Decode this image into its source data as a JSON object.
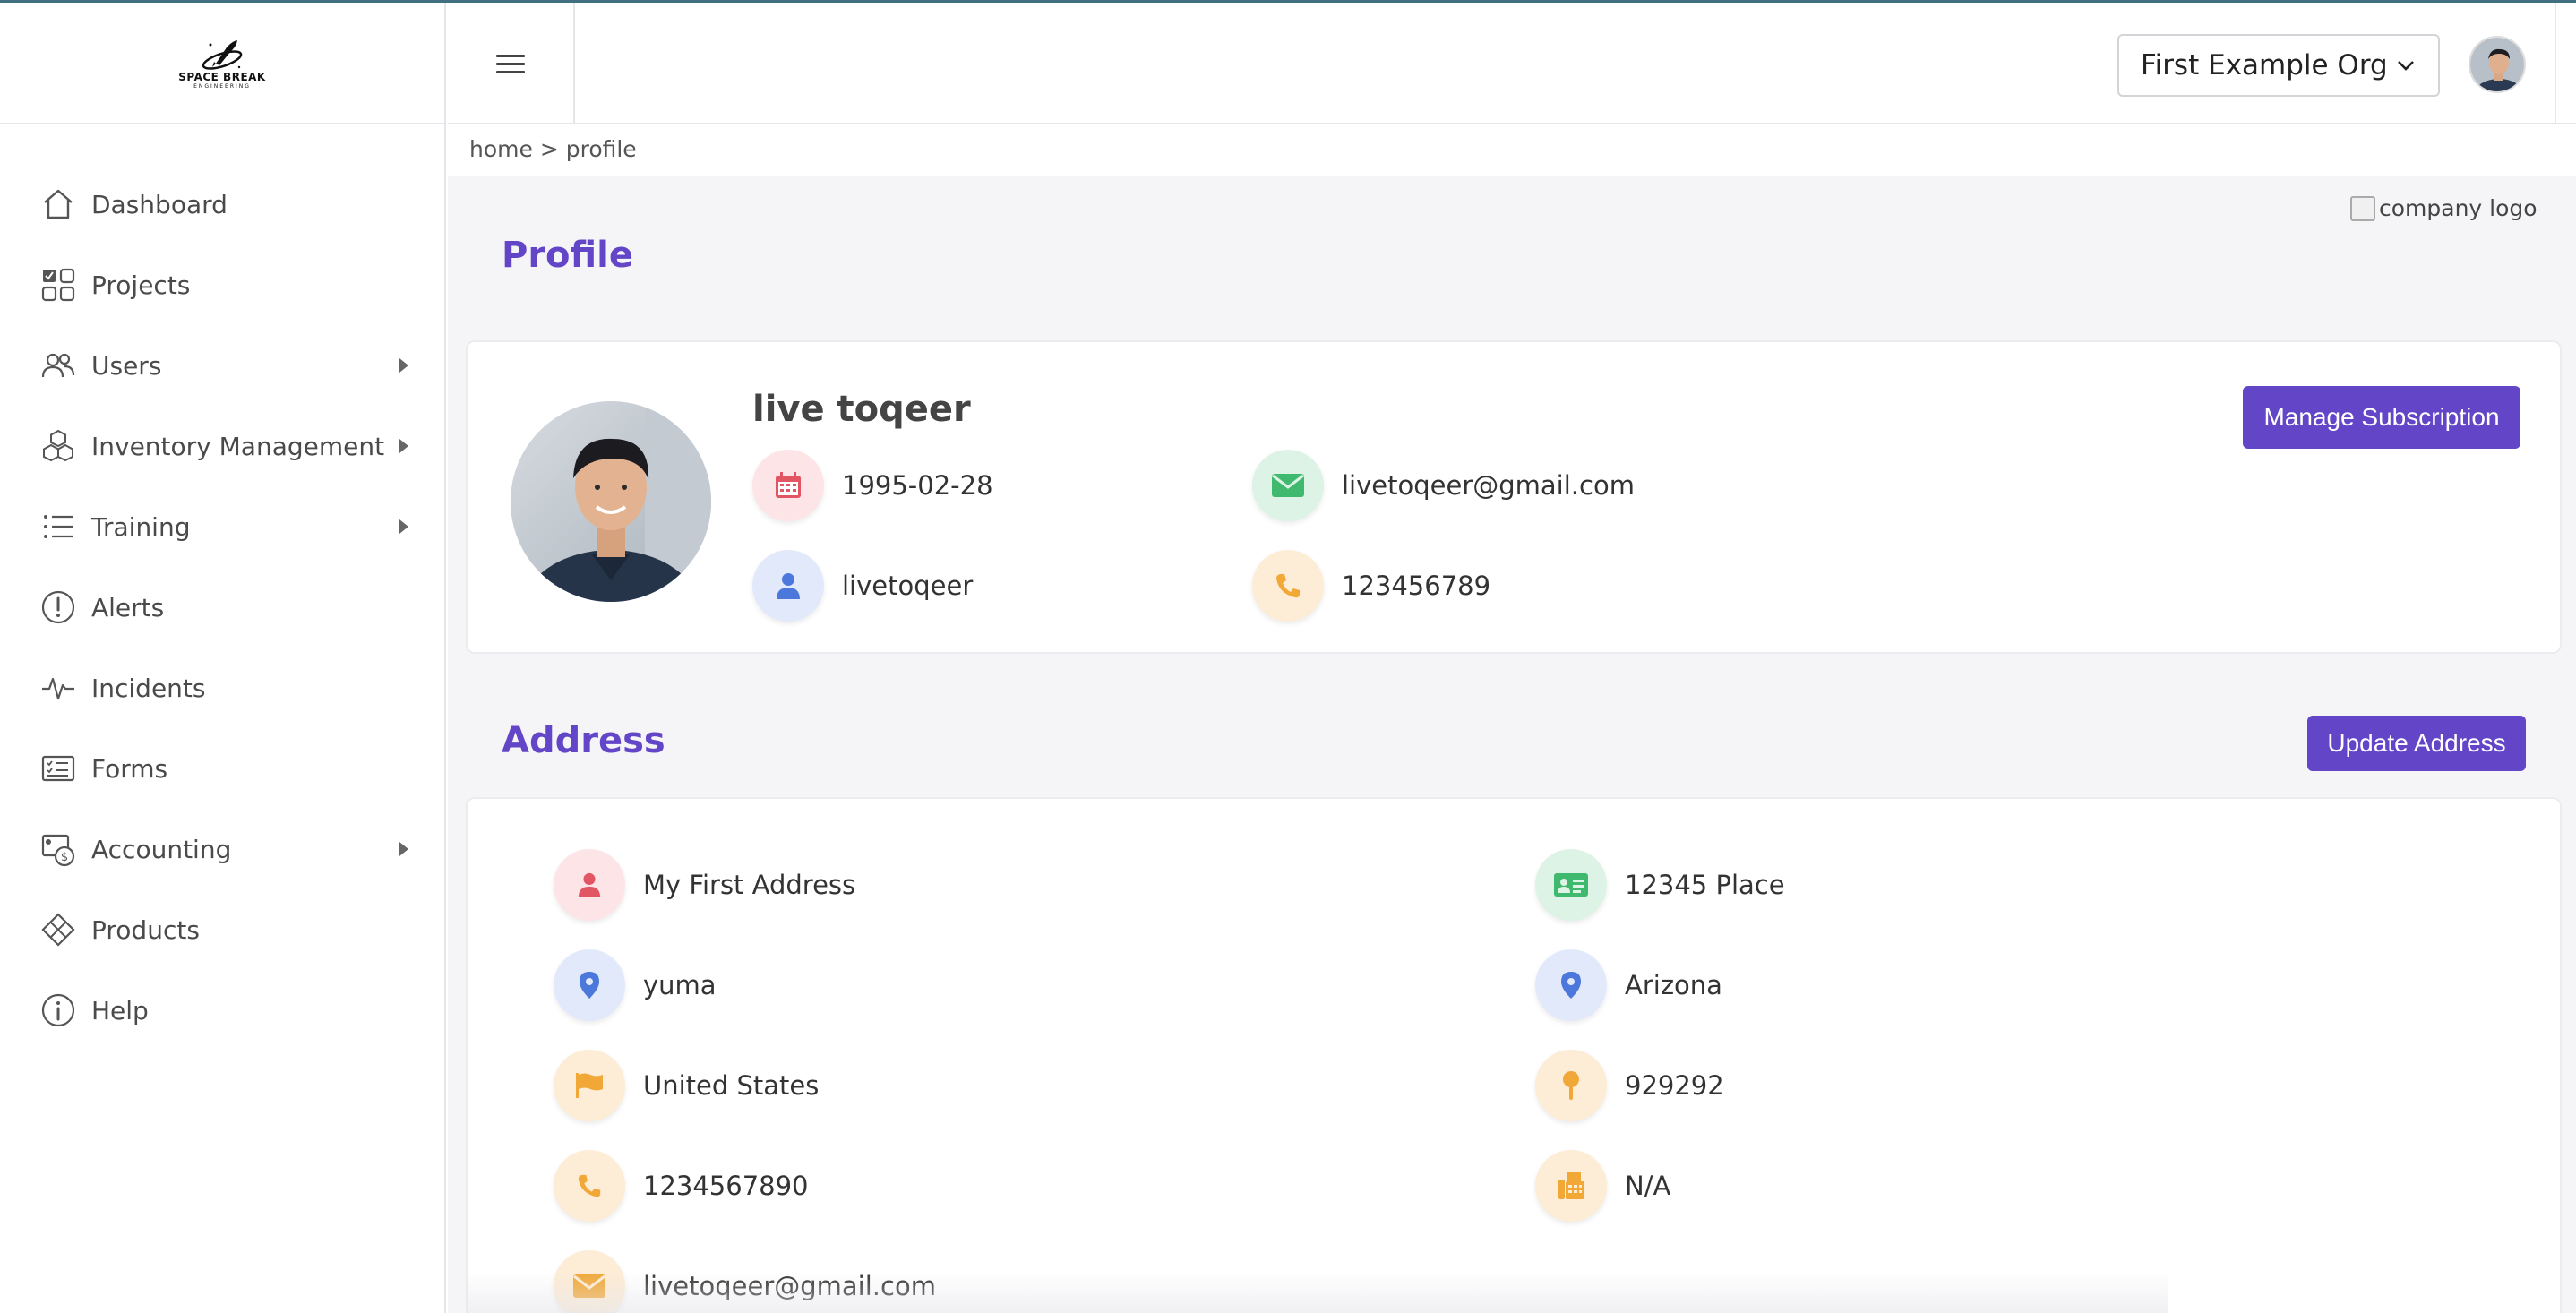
{
  "brand": {
    "logo_text": "SPACE BREAK",
    "logo_sub": "ENGINEERING"
  },
  "sidebar": {
    "items": [
      {
        "label": "Dashboard",
        "icon": "home-icon",
        "has_submenu": false
      },
      {
        "label": "Projects",
        "icon": "projects-grid-icon",
        "has_submenu": false
      },
      {
        "label": "Users",
        "icon": "users-icon",
        "has_submenu": true
      },
      {
        "label": "Inventory Management",
        "icon": "cubes-icon",
        "has_submenu": true
      },
      {
        "label": "Training",
        "icon": "list-icon",
        "has_submenu": true
      },
      {
        "label": "Alerts",
        "icon": "alert-icon",
        "has_submenu": false
      },
      {
        "label": "Incidents",
        "icon": "pulse-icon",
        "has_submenu": false
      },
      {
        "label": "Forms",
        "icon": "form-icon",
        "has_submenu": false
      },
      {
        "label": "Accounting",
        "icon": "accounting-icon",
        "has_submenu": true
      },
      {
        "label": "Products",
        "icon": "products-icon",
        "has_submenu": false
      },
      {
        "label": "Help",
        "icon": "info-icon",
        "has_submenu": false
      }
    ]
  },
  "header": {
    "org_selected": "First Example Org"
  },
  "breadcrumb": "home > profile",
  "company_logo_alt": "company logo",
  "profile": {
    "title": "Profile",
    "name": "live toqeer",
    "dob": "1995-02-28",
    "email": "livetoqeer@gmail.com",
    "username": "livetoqeer",
    "phone": "123456789",
    "manage_button": "Manage Subscription"
  },
  "address": {
    "title": "Address",
    "update_button": "Update Address",
    "name": "My First Address",
    "line1": "12345 Place",
    "city": "yuma",
    "state": "Arizona",
    "country": "United States",
    "zip": "929292",
    "phone": "1234567890",
    "fax": "N/A",
    "email": "livetoqeer@gmail.com"
  },
  "colors": {
    "accent": "#6346c8",
    "red": "#e25563",
    "green": "#3fb96e",
    "blue": "#4c78dc",
    "orange": "#f1a837"
  }
}
